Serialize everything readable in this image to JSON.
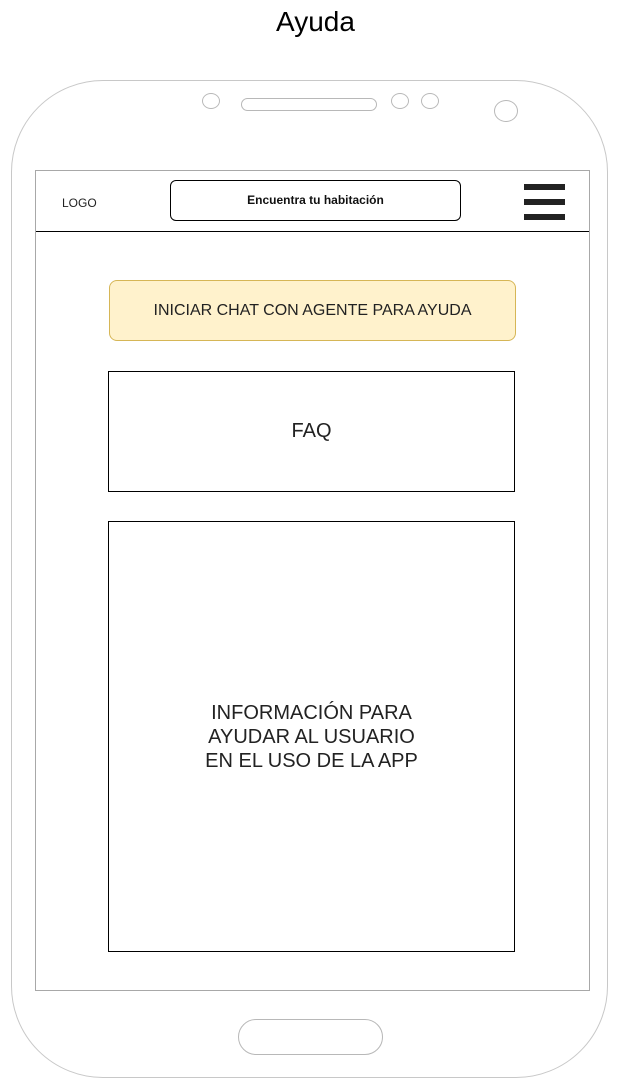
{
  "page": {
    "title": "Ayuda"
  },
  "header": {
    "logo_text": "LOGO",
    "search_label": "Encuentra tu habitación",
    "menu_icon": "hamburger-menu-icon"
  },
  "main": {
    "chat_button_label": "INICIAR CHAT CON AGENTE PARA AYUDA",
    "faq_label": "FAQ",
    "info_text": "INFORMACIÓN PARA AYUDAR AL USUARIO EN EL USO DE LA APP"
  },
  "colors": {
    "chat_button_fill": "#fff2cc",
    "chat_button_border": "#d6b656",
    "device_outline": "#c8c8c8"
  }
}
